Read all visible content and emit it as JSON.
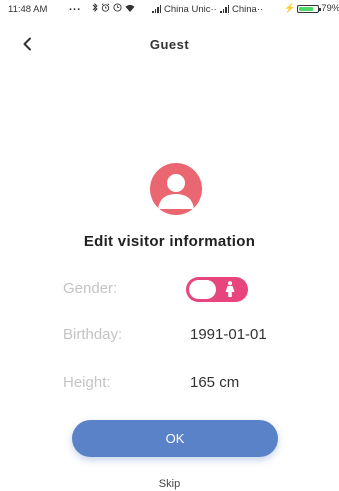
{
  "status_bar": {
    "time": "11:48 AM",
    "dots": "...",
    "carrier_1": "China Unic··",
    "carrier_2": "China··",
    "battery_percent": "79%",
    "battery_level": 0.79,
    "icons": [
      "bluetooth-icon",
      "alarm-icon",
      "clock-icon",
      "wifi-icon",
      "signal-icon",
      "signal-icon",
      "charging-icon",
      "battery-icon"
    ]
  },
  "nav": {
    "back_icon": "chevron-left-icon",
    "title": "Guest"
  },
  "avatar_icon": "user-avatar-icon",
  "heading": "Edit visitor information",
  "form": {
    "gender_label": "Gender:",
    "gender_value": "female",
    "gender_icon": "female-icon",
    "birthday_label": "Birthday:",
    "birthday_value": "1991-01-01",
    "height_label": "Height:",
    "height_value": "165 cm"
  },
  "ok_label": "OK",
  "skip_label": "Skip",
  "colors": {
    "accent_pink": "#e8457f",
    "avatar_red": "#ea6670",
    "ok_blue": "#5a82c9",
    "label_gray": "#c4c4c4",
    "battery_green": "#4cd964"
  }
}
